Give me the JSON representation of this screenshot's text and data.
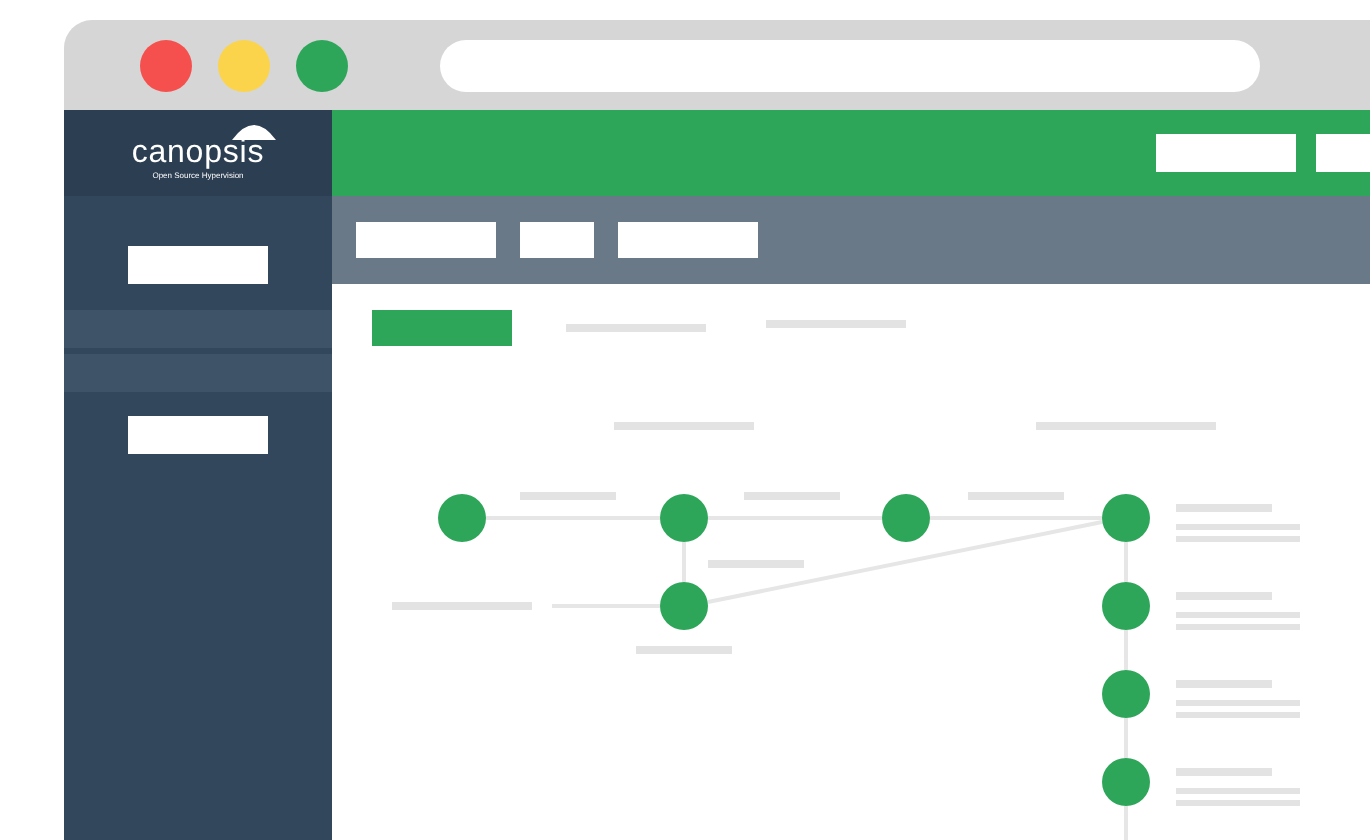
{
  "window_controls": [
    {
      "color": "#f5504e"
    },
    {
      "color": "#fbd44b"
    },
    {
      "color": "#2ea65a"
    }
  ],
  "logo": {
    "name": "canopsis",
    "tagline": "Open Source Hypervision"
  }
}
